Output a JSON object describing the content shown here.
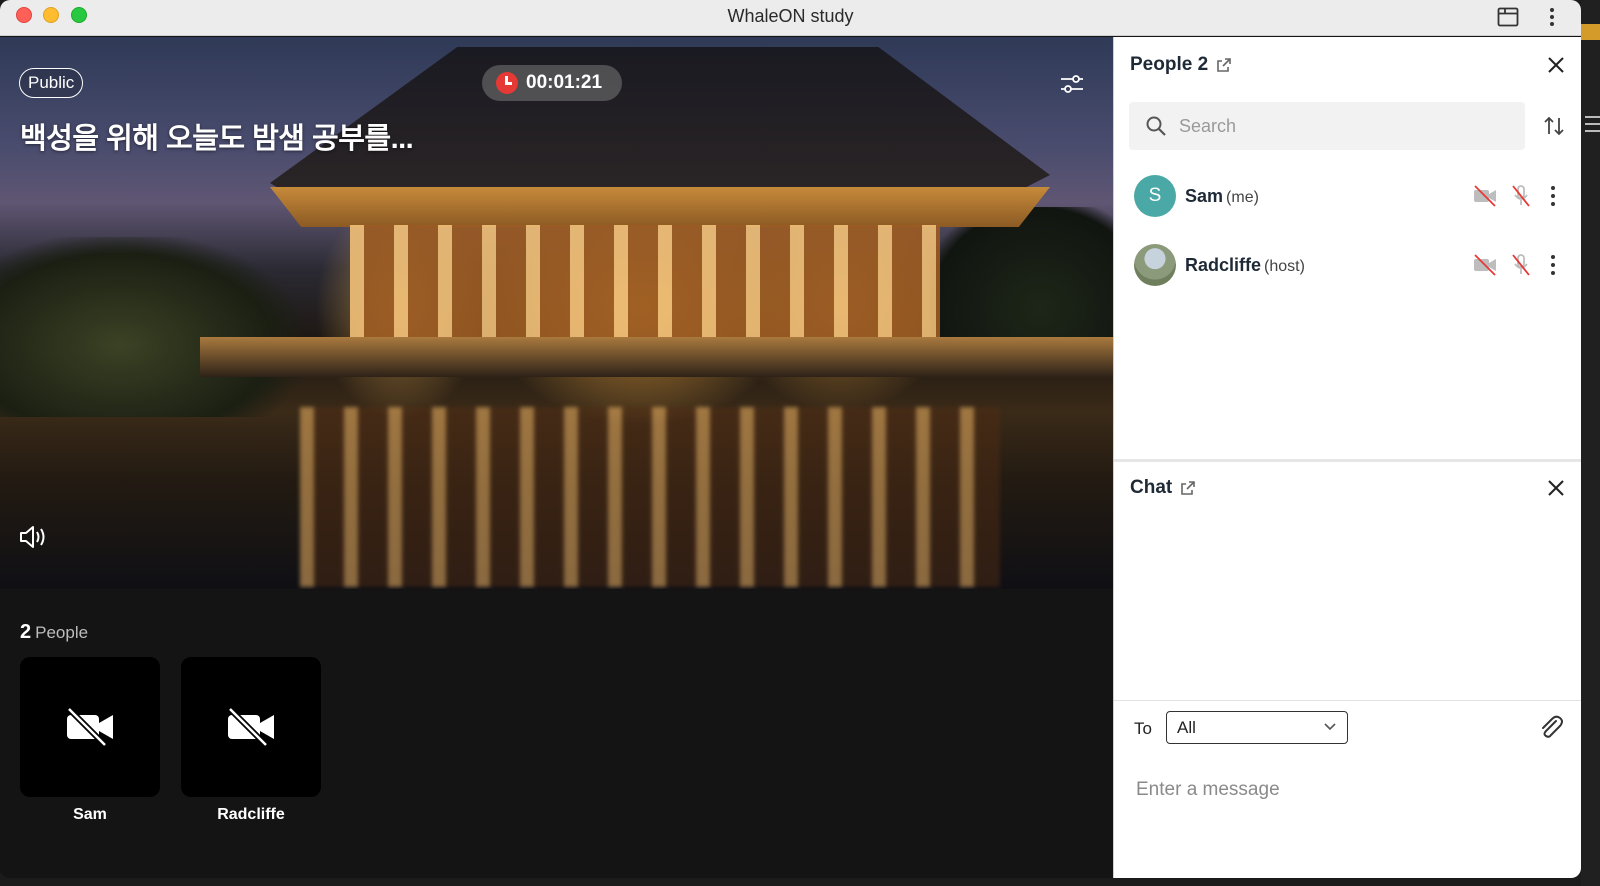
{
  "window": {
    "title": "WhaleON study"
  },
  "stage": {
    "visibility_badge": "Public",
    "room_title": "백성을 위해 오늘도 밤샘 공부를...",
    "timer": "00:01:21"
  },
  "people_strip": {
    "count": "2",
    "label": "People",
    "tiles": [
      {
        "name": "Sam"
      },
      {
        "name": "Radcliffe"
      }
    ]
  },
  "people_panel": {
    "title": "People 2",
    "search_placeholder": "Search",
    "members": [
      {
        "initial": "S",
        "name": "Sam",
        "role": "(me)",
        "avatar_color": "#4aa8a6"
      },
      {
        "initial": "",
        "name": "Radcliffe",
        "role": "(host)"
      }
    ]
  },
  "chat_panel": {
    "title": "Chat",
    "to_label": "To",
    "to_selected": "All",
    "message_placeholder": "Enter a message"
  },
  "icons": {
    "timer": "alarm-clock-icon",
    "settings": "sliders-icon",
    "volume": "speaker-icon",
    "camera_off": "camera-off-icon",
    "mic_off": "mic-off-icon",
    "popout": "external-link-icon",
    "close": "close-icon",
    "sort": "sort-arrows-icon",
    "attach": "paperclip-icon"
  }
}
